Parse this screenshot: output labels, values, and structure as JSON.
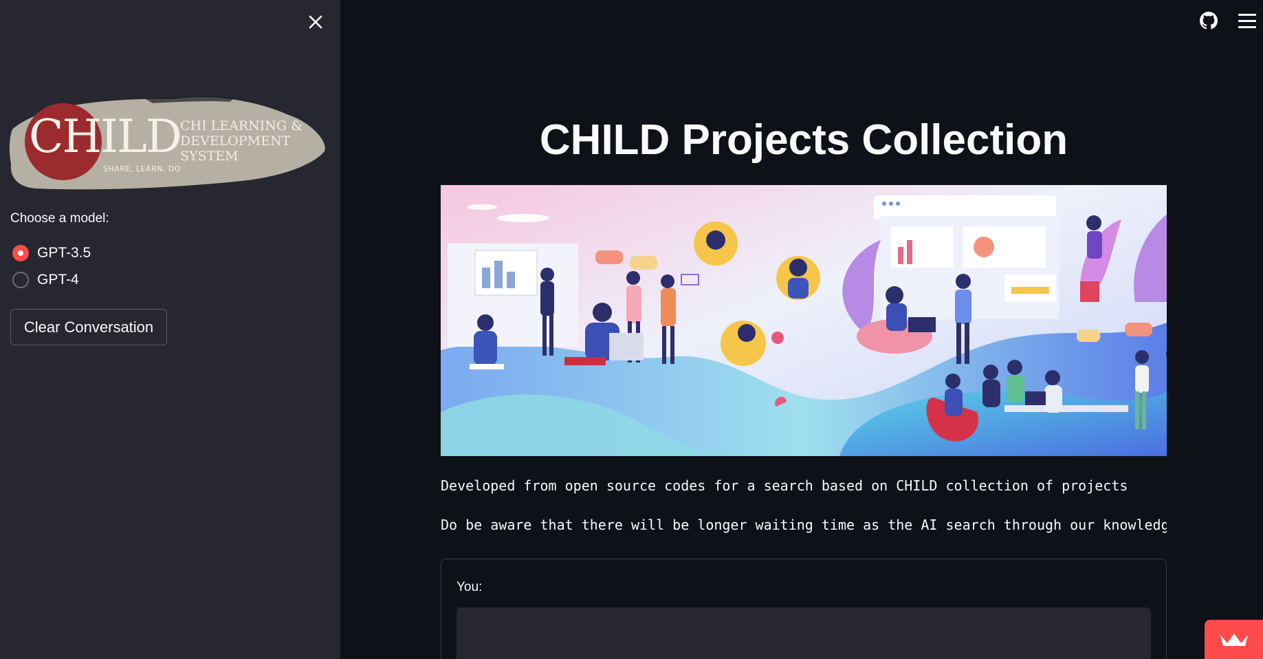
{
  "sidebar": {
    "logo": {
      "monogram": "CHILD",
      "lines": [
        "CHI LEARNING &",
        "DEVELOPMENT",
        "SYSTEM"
      ],
      "tagline": "SHARE, LEARN, DO"
    },
    "model_label": "Choose a model:",
    "models": [
      {
        "label": "GPT-3.5",
        "selected": true
      },
      {
        "label": "GPT-4",
        "selected": false
      }
    ],
    "clear_label": "Clear Conversation"
  },
  "main": {
    "title": "CHILD Projects Collection",
    "desc1": "Developed from open source codes for a search based on CHILD collection of projects",
    "desc2": "Do be aware that there will be longer waiting time as the AI search through our knowledge base",
    "you_label": "You:"
  },
  "colors": {
    "accent": "#ff4b4b",
    "sidebar_bg": "#262730",
    "main_bg": "#0e1117"
  },
  "icons": [
    "close-icon",
    "github-icon",
    "menu-icon",
    "crown-icon"
  ]
}
